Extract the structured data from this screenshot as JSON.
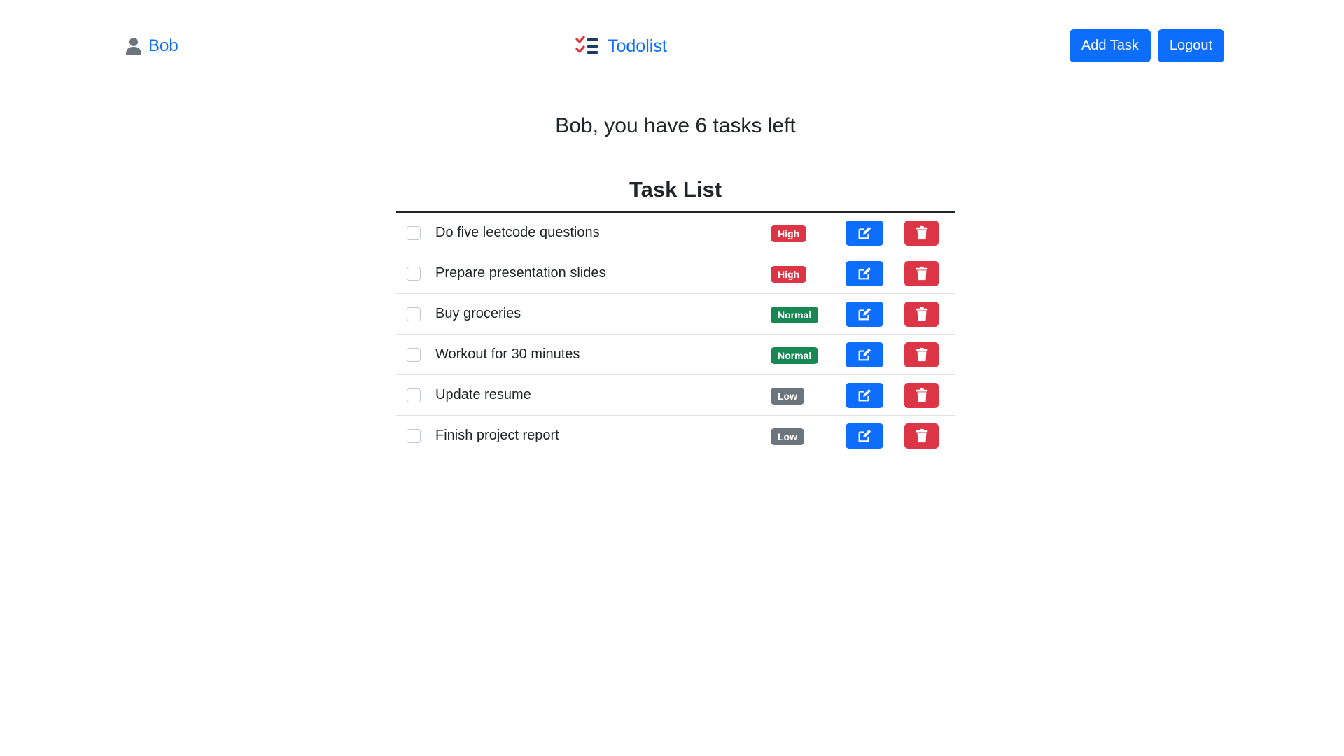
{
  "navbar": {
    "user_name": "Bob",
    "brand": "Todolist",
    "add_task_label": "Add Task",
    "logout_label": "Logout",
    "icons": {
      "user": "user-icon",
      "brand": "checklist-icon"
    }
  },
  "subtitle": "Bob, you have 6 tasks left",
  "list_title": "Task List",
  "colors": {
    "primary": "#0d6efd",
    "danger": "#dc3545",
    "success": "#198754",
    "secondary": "#6c757d"
  },
  "tasks": [
    {
      "text": "Do five leetcode questions",
      "priority": "High"
    },
    {
      "text": "Prepare presentation slides",
      "priority": "High"
    },
    {
      "text": "Buy groceries",
      "priority": "Normal"
    },
    {
      "text": "Workout for 30 minutes",
      "priority": "Normal"
    },
    {
      "text": "Update resume",
      "priority": "Low"
    },
    {
      "text": "Finish project report",
      "priority": "Low"
    }
  ],
  "row_icons": {
    "edit": "edit-icon",
    "delete": "trash-icon"
  }
}
